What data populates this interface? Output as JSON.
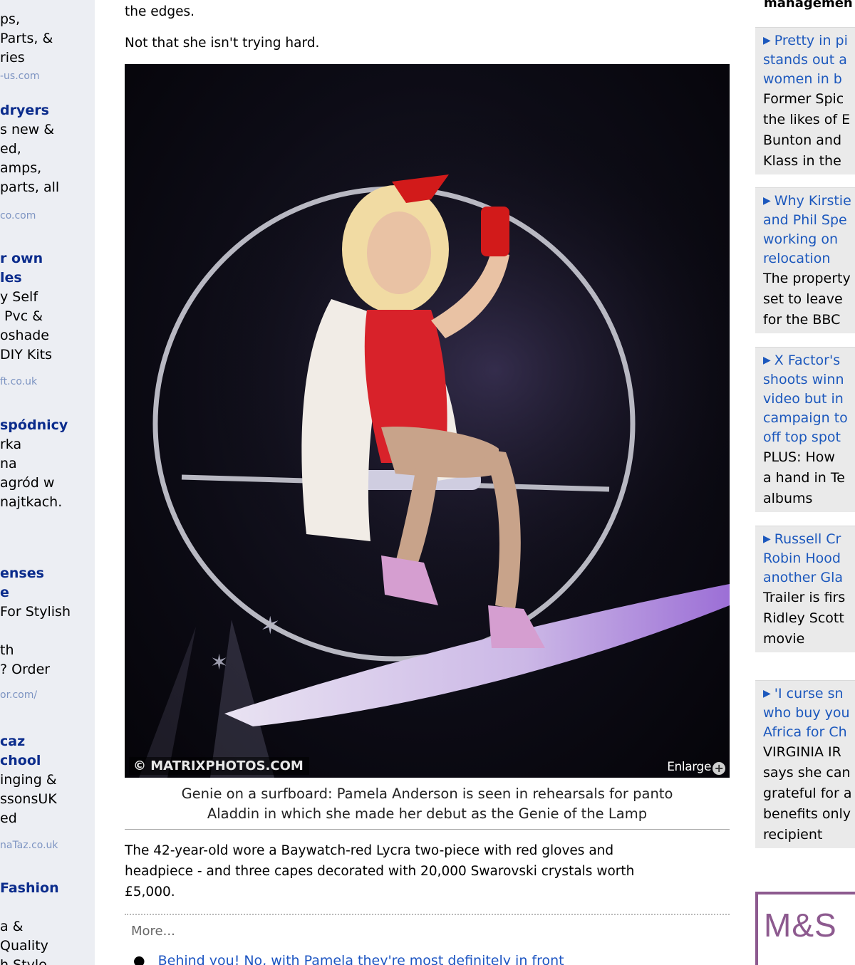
{
  "left_ads": [
    {
      "title": "",
      "desc": [
        "ps,",
        "Parts, &",
        "ries"
      ],
      "url": "-us.com"
    },
    {
      "title": "dryers",
      "desc": [
        "s new &",
        "ed,",
        "amps,",
        "parts, all"
      ],
      "url": "co.com"
    },
    {
      "title": "r own\nles",
      "desc": [
        "y Self",
        " Pvc &",
        "oshade",
        "DIY Kits"
      ],
      "url": "ft.co.uk"
    },
    {
      "title": "spódnicy",
      "desc": [
        "rka",
        "na",
        "agród w",
        "najtkach."
      ],
      "url": ""
    },
    {
      "title": "enses\ne",
      "desc": [
        "For Stylish",
        "",
        "th",
        "? Order"
      ],
      "url": "or.com/"
    },
    {
      "title": "caz\nchool",
      "desc": [
        "inging &",
        "ssonsUK",
        "ed"
      ],
      "url": "naTaz.co.uk"
    },
    {
      "title": "Fashion",
      "desc": [
        "",
        "a &",
        "Quality",
        "h Style"
      ],
      "url": ""
    }
  ],
  "article": {
    "para_top": "the edges.",
    "para_2": "Not that she isn't trying hard.",
    "photo_credit": "© MATRIXPHOTOS.COM",
    "enlarge_label": "Enlarge",
    "caption_line1": "Genie on a surfboard: Pamela Anderson is seen in rehearsals for panto",
    "caption_line2": "Aladdin in which she made her debut as the Genie of the Lamp",
    "body": [
      "The 42-year-old wore a Baywatch-red Lycra two-piece with red gloves and",
      "headpiece - and three capes decorated with 20,000 Swarovski crystals worth",
      "£5,000."
    ],
    "more_label": "More...",
    "more_links": [
      "Behind you! No, with Pamela they're most definitely in front"
    ]
  },
  "sidebar": {
    "top_snippet": "managemen",
    "stories": [
      {
        "title": [
          "Pretty in pi",
          "stands out a",
          "women in b"
        ],
        "text": [
          "Former Spic",
          "the likes of E",
          "Bunton and",
          "Klass in the"
        ]
      },
      {
        "title": [
          "Why Kirstie",
          "and Phil Spe",
          "working on",
          "relocation"
        ],
        "text": [
          "The property",
          "set to leave",
          "for the BBC"
        ]
      },
      {
        "title": [
          "X Factor's",
          "shoots winn",
          "video but in",
          "campaign to",
          "off top spot"
        ],
        "text": [
          "PLUS: How",
          "a hand in Te",
          "albums"
        ]
      },
      {
        "title": [
          "Russell Cr",
          "Robin Hood",
          "another Gla"
        ],
        "text": [
          "Trailer is firs",
          "Ridley Scott",
          "movie"
        ]
      },
      {
        "title": [
          "'I curse sn",
          "who buy you",
          "Africa for Ch"
        ],
        "text": [
          "VIRGINIA IR",
          "says she can",
          "grateful for a",
          "benefits only",
          "recipient"
        ]
      }
    ],
    "ms_logo": "M&S"
  },
  "colors": {
    "link_blue": "#1c58bd",
    "ad_title_blue": "#0b2c8c",
    "ms_purple": "#8d5a8f"
  }
}
